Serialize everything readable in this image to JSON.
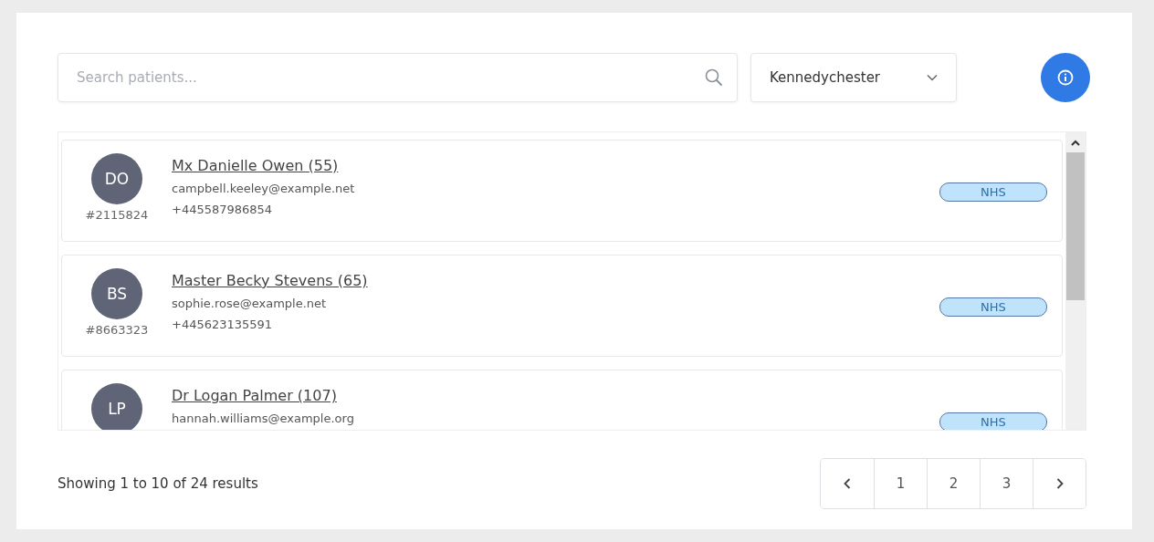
{
  "search": {
    "placeholder": "Search patients..."
  },
  "location_dropdown": {
    "value": "Kennedychester"
  },
  "patients": [
    {
      "initials": "DO",
      "id": "#2115824",
      "name": "Mx Danielle Owen (55)",
      "email": "campbell.keeley@example.net",
      "phone": "+445587986854",
      "tag": "NHS"
    },
    {
      "initials": "BS",
      "id": "#8663323",
      "name": "Master Becky Stevens (65)",
      "email": "sophie.rose@example.net",
      "phone": "+445623135591",
      "tag": "NHS"
    },
    {
      "initials": "LP",
      "name": "Dr Logan Palmer (107)",
      "email": "hannah.williams@example.org",
      "tag": "NHS"
    }
  ],
  "summary": "Showing 1 to 10 of 24 results",
  "pagination": {
    "pages": [
      {
        "label": "1",
        "selected": false
      },
      {
        "label": "2",
        "selected": false
      },
      {
        "label": "3",
        "selected": false
      }
    ]
  }
}
